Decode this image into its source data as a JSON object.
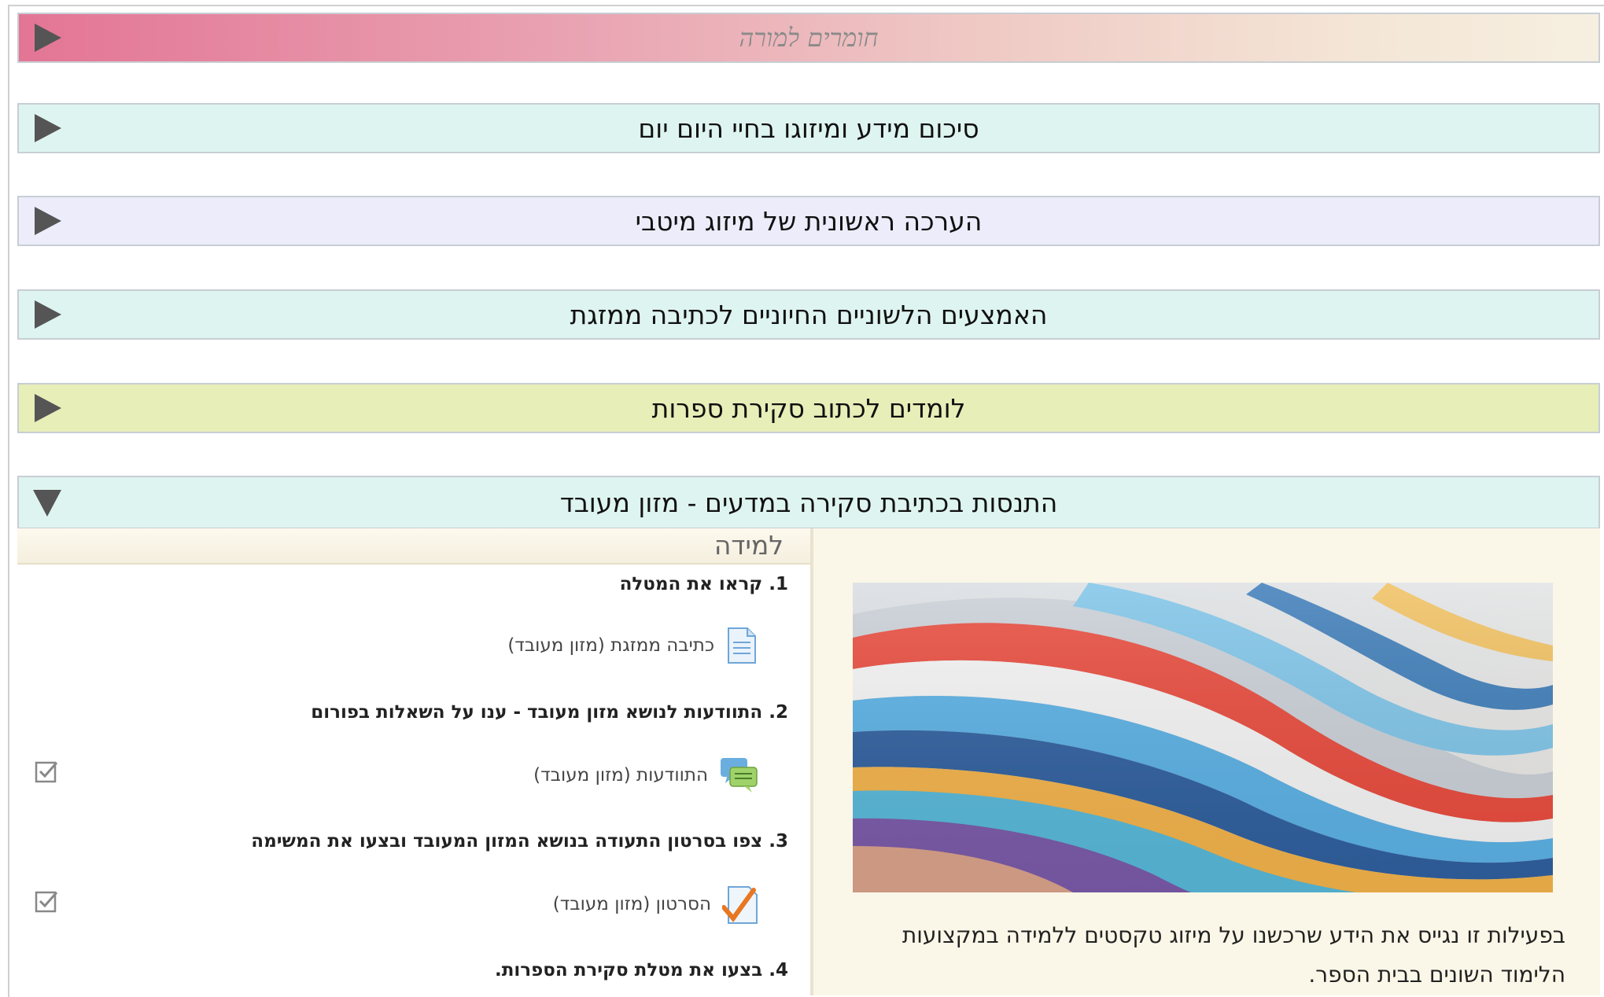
{
  "sections": {
    "teacher": "חומרים למורה",
    "s1": "סיכום מידע ומיזוגו בחיי היום יום",
    "s2": "הערכה ראשונית של מיזוג מיטבי",
    "s3": "האמצעים הלשוניים החיוניים לכתיבה ממזגת",
    "s4": "לומדים לכתוב סקירת ספרות",
    "s5": "התנסות בכתיבת סקירה במדעים - מזון מעובד"
  },
  "learning": {
    "tab_label": "למידה",
    "step1": "1. קראו את המטלה",
    "res1": "כתיבה ממזגת (מזון מעובד)",
    "step2": "2. התוודעות לנושא מזון מעובד - ענו על השאלות בפורום",
    "res2": "התוודעות (מזון מעובד)",
    "step3": "3. צפו בסרטון התעודה בנושא המזון המעובד ובצעו את המשימה",
    "res3": "הסרטון (מזון מעובד)",
    "step4": "4. בצעו את מטלת סקירת הספרות."
  },
  "description": "בפעילות זו נגייס את הידע שרכשנו על מיזוג טקסטים ללמידה במקצועות הלימוד השונים בבית הספר.",
  "icons": [
    "play-arrow-icon",
    "expand-arrow-icon",
    "document-icon",
    "forum-icon",
    "assignment-icon",
    "checkbox-icon"
  ],
  "colors": {
    "teacher_start": "#e37595",
    "mint": "#def4f0",
    "lavender": "#ececfb",
    "yellow": "#e7eeb8",
    "arrow": "#555555"
  }
}
